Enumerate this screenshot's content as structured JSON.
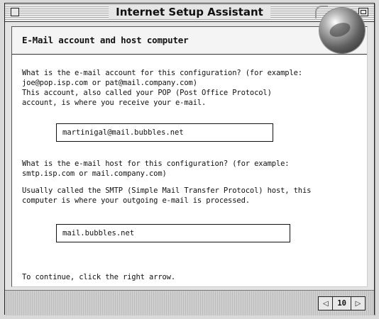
{
  "window": {
    "title": "Internet Setup Assistant"
  },
  "section": {
    "heading": "E-Mail account and host computer"
  },
  "account": {
    "question_line1": "What is the e-mail account for this configuration? (for example:",
    "question_line2": "joe@pop.isp.com or pat@mail.company.com)",
    "help_line1": "This account, also called your POP (Post Office Protocol)",
    "help_line2": "account, is where you receive your e-mail.",
    "value": "martinigal@mail.bubbles.net"
  },
  "host": {
    "question_line1": "What is the e-mail host for this configuration? (for example:",
    "question_line2": "smtp.isp.com or mail.company.com)",
    "help_line1": "Usually called the SMTP (Simple Mail Transfer Protocol) host, this",
    "help_line2": "computer is where your outgoing e-mail is processed.",
    "value": "mail.bubbles.net"
  },
  "instructions": "To continue, click the right arrow.",
  "navigation": {
    "page": "10",
    "prev_glyph": "◁",
    "next_glyph": "▷"
  }
}
